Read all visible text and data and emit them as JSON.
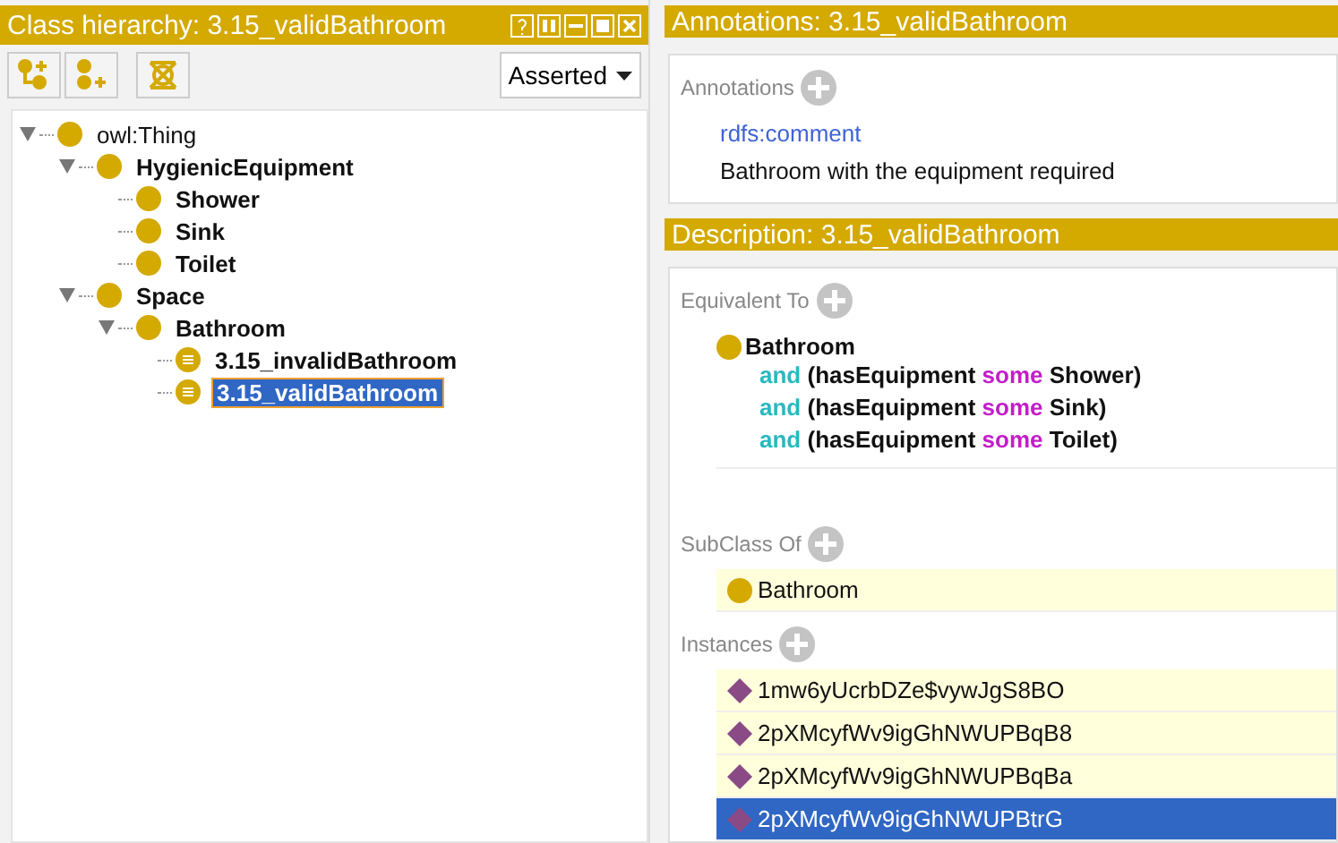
{
  "hierarchy": {
    "title": "Class hierarchy: 3.15_validBathroom",
    "mode": "Asserted",
    "tree": [
      {
        "label": "owl:Thing",
        "kind": "class",
        "bold": false,
        "selected": false,
        "expanded": true,
        "children": [
          {
            "label": "HygienicEquipment",
            "kind": "class",
            "bold": true,
            "selected": false,
            "expanded": true,
            "children": [
              {
                "label": "Shower",
                "kind": "class",
                "bold": true,
                "selected": false
              },
              {
                "label": "Sink",
                "kind": "class",
                "bold": true,
                "selected": false
              },
              {
                "label": "Toilet",
                "kind": "class",
                "bold": true,
                "selected": false
              }
            ]
          },
          {
            "label": "Space",
            "kind": "class",
            "bold": true,
            "selected": false,
            "expanded": true,
            "children": [
              {
                "label": "Bathroom",
                "kind": "class",
                "bold": true,
                "selected": false,
                "expanded": true,
                "children": [
                  {
                    "label": "3.15_invalidBathroom",
                    "kind": "defined",
                    "bold": true,
                    "selected": false
                  },
                  {
                    "label": "3.15_validBathroom",
                    "kind": "defined",
                    "bold": true,
                    "selected": true
                  }
                ]
              }
            ]
          }
        ]
      }
    ]
  },
  "annotations": {
    "title": "Annotations: 3.15_validBathroom",
    "section": "Annotations",
    "property": "rdfs:comment",
    "value": "Bathroom with the equipment required"
  },
  "description": {
    "title": "Description: 3.15_validBathroom",
    "equivalent_to": {
      "label": "Equivalent To",
      "class": "Bathroom",
      "lines": [
        [
          {
            "text": "and",
            "kind": "keyword"
          },
          {
            "text": "(hasEquipment",
            "kind": "name"
          },
          {
            "text": "some",
            "kind": "quantifier"
          },
          {
            "text": "Shower)",
            "kind": "name"
          }
        ],
        [
          {
            "text": "and",
            "kind": "keyword"
          },
          {
            "text": "(hasEquipment",
            "kind": "name"
          },
          {
            "text": "some",
            "kind": "quantifier"
          },
          {
            "text": "Sink)",
            "kind": "name"
          }
        ],
        [
          {
            "text": "and",
            "kind": "keyword"
          },
          {
            "text": "(hasEquipment",
            "kind": "name"
          },
          {
            "text": "some",
            "kind": "quantifier"
          },
          {
            "text": "Toilet)",
            "kind": "name"
          }
        ]
      ]
    },
    "subclass_of": {
      "label": "SubClass Of",
      "items": [
        "Bathroom"
      ]
    },
    "instances": {
      "label": "Instances",
      "items": [
        {
          "label": "1mw6yUcrbDZe$vywJgS8BO",
          "selected": false
        },
        {
          "label": "2pXMcyfWv9igGhNWUPBqB8",
          "selected": false
        },
        {
          "label": "2pXMcyfWv9igGhNWUPBqBa",
          "selected": false
        },
        {
          "label": "2pXMcyfWv9igGhNWUPBtrG",
          "selected": true
        }
      ]
    }
  }
}
